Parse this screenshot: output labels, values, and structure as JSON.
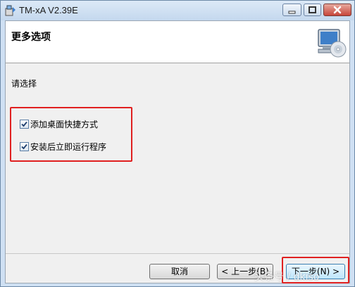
{
  "window": {
    "title": "TM-xA V2.39E"
  },
  "header": {
    "title": "更多选项"
  },
  "content": {
    "prompt": "请选择",
    "options": [
      {
        "label": "添加桌面快捷方式",
        "checked": true
      },
      {
        "label": "安装后立即运行程序",
        "checked": true
      }
    ]
  },
  "footer": {
    "cancel_label": "取消",
    "back_label": "< 上一步(B)",
    "next_label": "下一步(N) >"
  },
  "watermark": "头条号 / dkiso",
  "colors": {
    "highlight_box": "#e02020",
    "next_button_border": "#3c7fb1"
  },
  "icons": {
    "app": "installer-icon",
    "header": "computer-cd-icon"
  }
}
